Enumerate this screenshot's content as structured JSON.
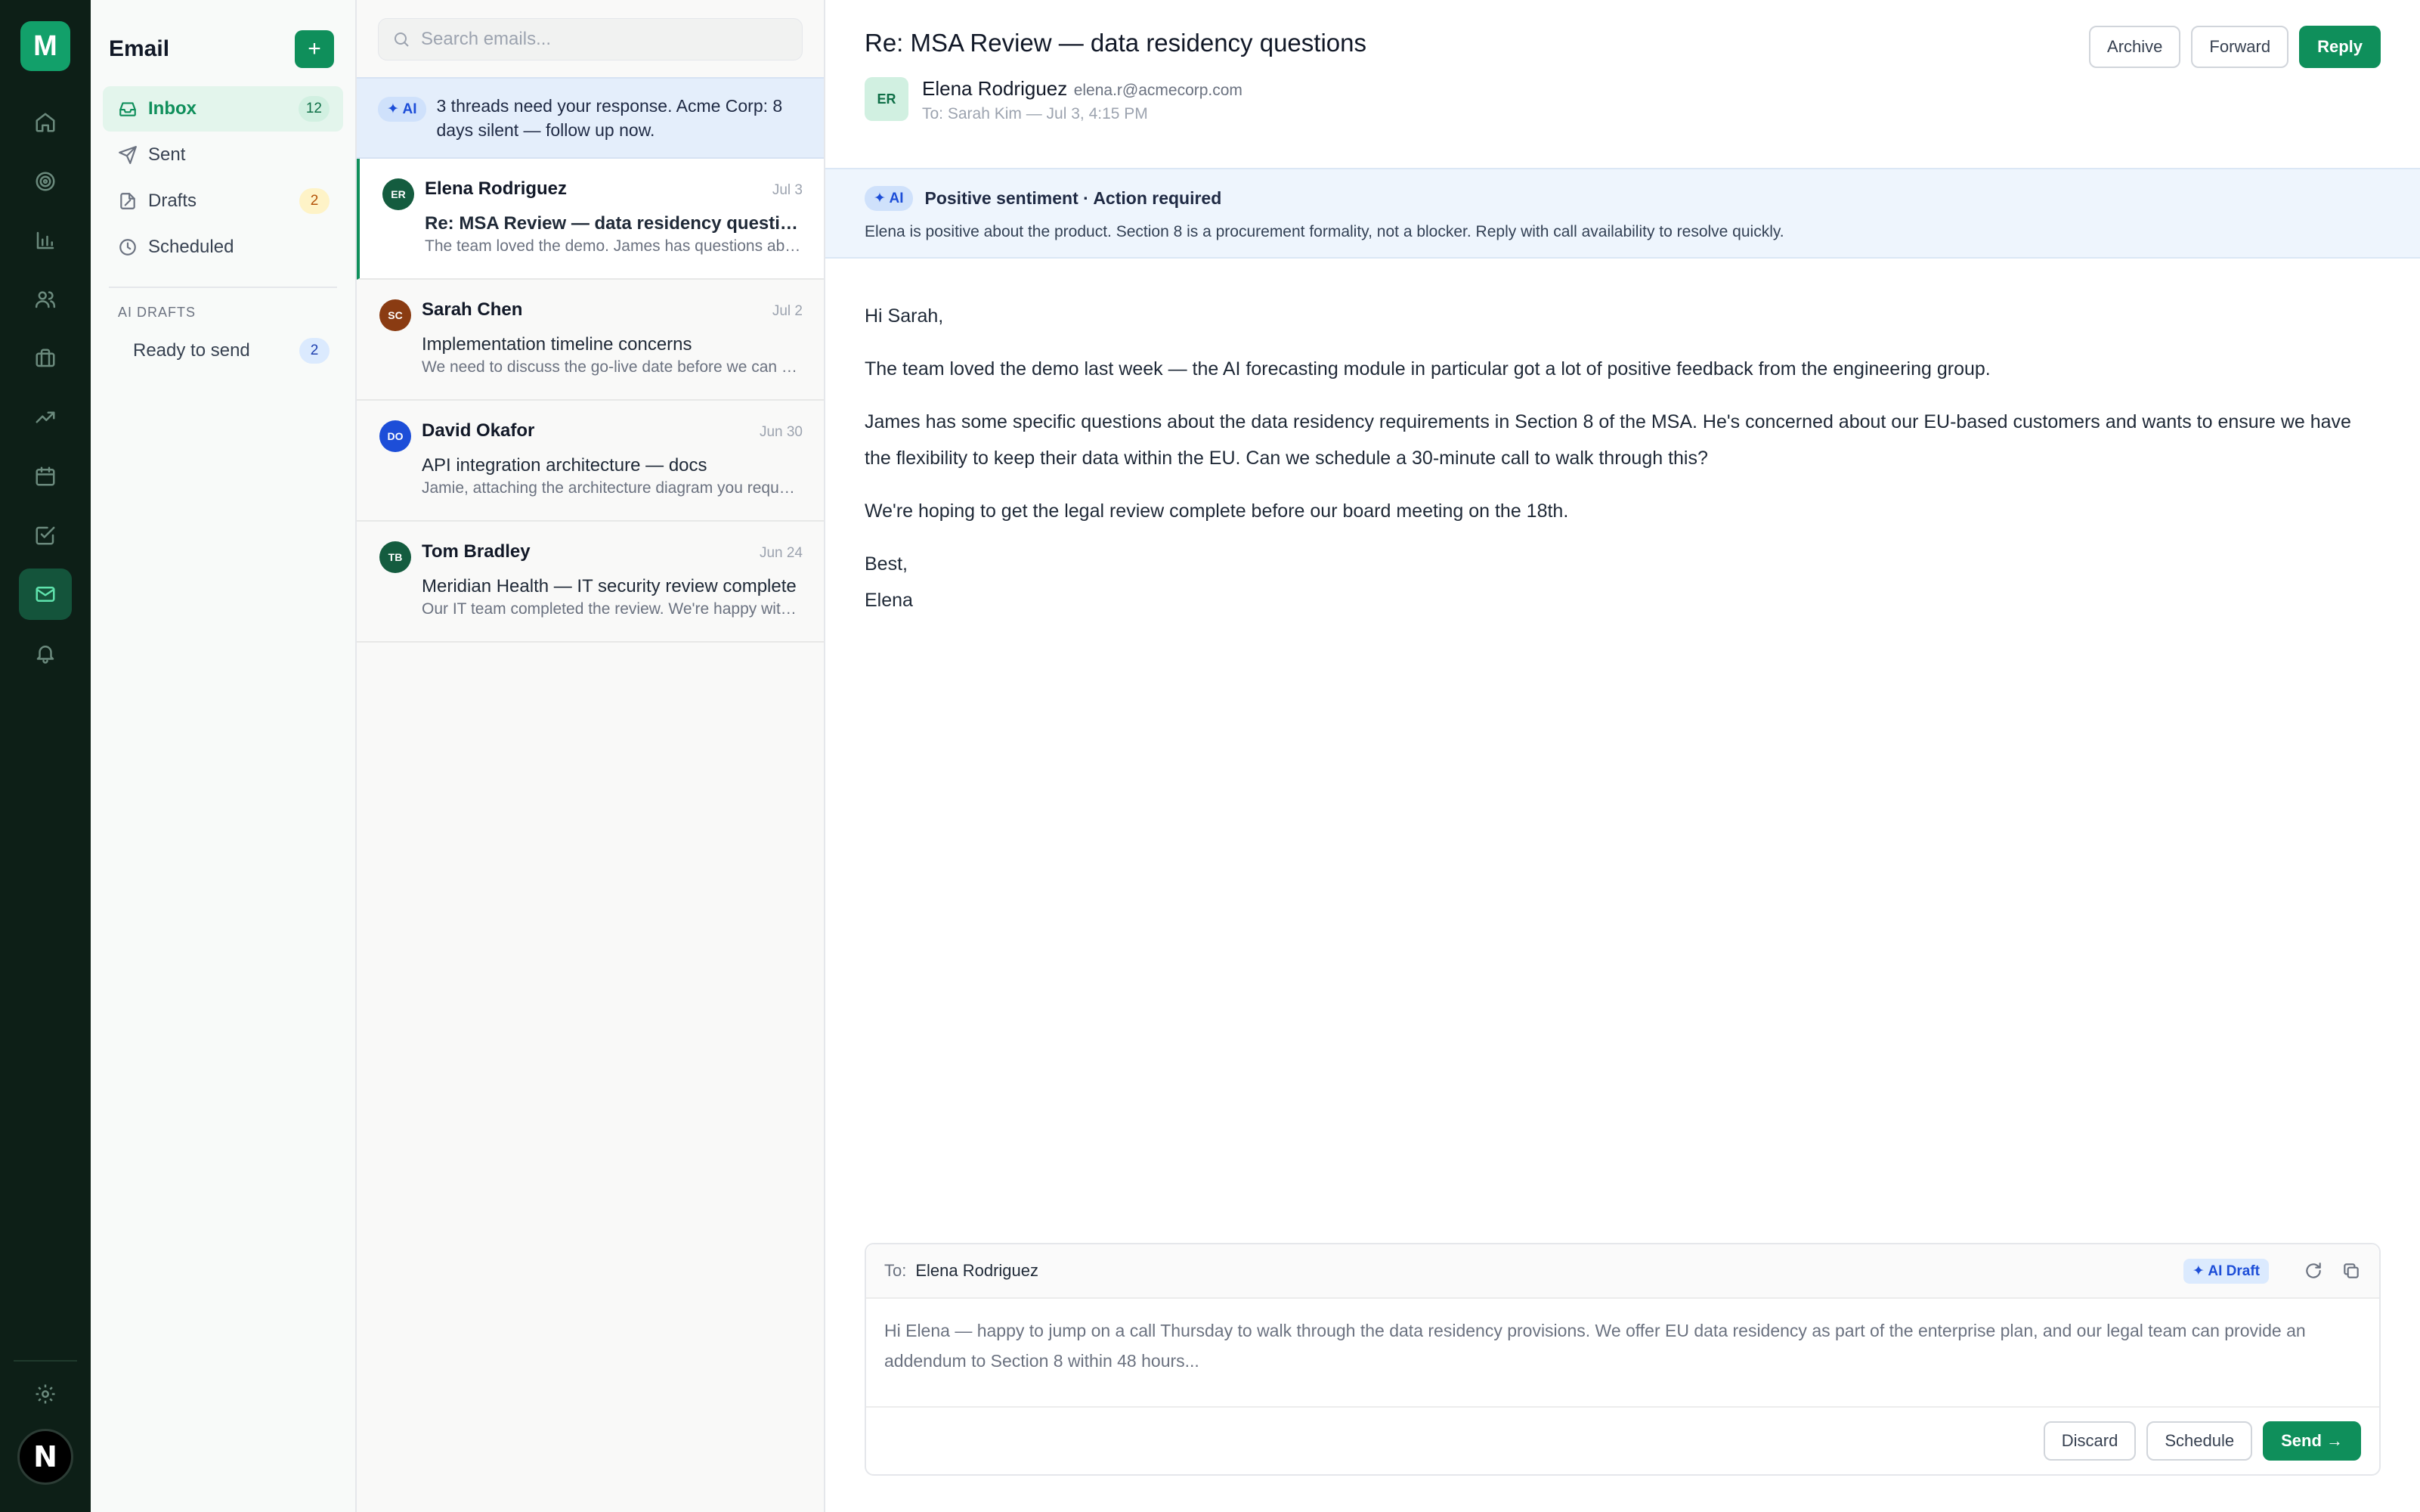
{
  "rail": {
    "logo": "M",
    "items": [
      "home-icon",
      "target-icon",
      "bar-chart-icon",
      "users-icon",
      "briefcase-icon",
      "trending-icon",
      "calendar-icon",
      "check-square-icon",
      "mail-icon",
      "bell-icon"
    ],
    "active": "mail-icon",
    "avatar": "N"
  },
  "folders": {
    "title": "Email",
    "compose_label": "+",
    "items": [
      {
        "label": "Inbox",
        "count": "12",
        "icon": "inbox-icon"
      },
      {
        "label": "Sent",
        "count": "",
        "icon": "send-icon"
      },
      {
        "label": "Drafts",
        "count": "2",
        "icon": "draft-icon"
      },
      {
        "label": "Scheduled",
        "count": "",
        "icon": "clock-icon"
      }
    ],
    "section_label": "AI DRAFTS",
    "ai_items": [
      {
        "label": "Ready to send",
        "count": "2"
      }
    ]
  },
  "list": {
    "search_placeholder": "Search emails...",
    "ai_chip": "✦ AI",
    "ai_banner": "3 threads need your response. Acme Corp: 8 days silent — follow up now.",
    "emails": [
      {
        "initials": "ER",
        "from": "Elena Rodriguez",
        "date": "Jul 3",
        "subject": "Re: MSA Review — data residency questions",
        "preview": "The team loved the demo. James has questions about the data residency requirements",
        "color": "#145c3f"
      },
      {
        "initials": "SC",
        "from": "Sarah Chen",
        "date": "Jul 2",
        "subject": "Implementation timeline concerns",
        "preview": "We need to discuss the go-live date before we can commit to the rollout plan",
        "color": "#8a3b12"
      },
      {
        "initials": "DO",
        "from": "David Okafor",
        "date": "Jun 30",
        "subject": "API integration architecture — docs",
        "preview": "Jamie, attaching the architecture diagram you requested last week for review",
        "color": "#1d4ed8"
      },
      {
        "initials": "TB",
        "from": "Tom Bradley",
        "date": "Jun 24",
        "subject": "Meridian Health — IT security review complete",
        "preview": "Our IT team completed the review. We're happy with the results and ready to proceed",
        "color": "#145c3f"
      }
    ]
  },
  "reader": {
    "subject": "Re: MSA Review — data residency questions",
    "actions": {
      "archive": "Archive",
      "forward": "Forward",
      "reply": "Reply"
    },
    "sender_initials": "ER",
    "sender_name": "Elena Rodriguez",
    "sender_email": "elena.r@acmecorp.com",
    "sender_to": "To: Sarah Kim — Jul 3, 4:15 PM",
    "insight_chip": "✦ AI",
    "insight_title": "Positive sentiment · Action required",
    "insight_text": "Elena is positive about the product. Section 8 is a procurement formality, not a blocker. Reply with call availability to resolve quickly.",
    "body": {
      "greeting": "Hi Sarah,",
      "p1": "The team loved the demo last week — the AI forecasting module in particular got a lot of positive feedback from the engineering group.",
      "p2": "James has some specific questions about the data residency requirements in Section 8 of the MSA. He's concerned about our EU-based customers and wants to ensure we have the flexibility to keep their data within the EU. Can we schedule a 30-minute call to walk through this?",
      "p3": "We're hoping to get the legal review complete before our board meeting on the 18th.",
      "signoff": "Best,",
      "signature": "Elena"
    }
  },
  "composer": {
    "to_label": "To:",
    "to": "Elena Rodriguez",
    "ai_draft": "✦ AI Draft",
    "text": "Hi Elena — happy to jump on a call Thursday to walk through the data residency provisions. We offer EU data residency as part of the enterprise plan, and our legal team can provide an addendum to Section 8 within 48 hours...",
    "discard": "Discard",
    "schedule": "Schedule",
    "send": "Send →"
  }
}
